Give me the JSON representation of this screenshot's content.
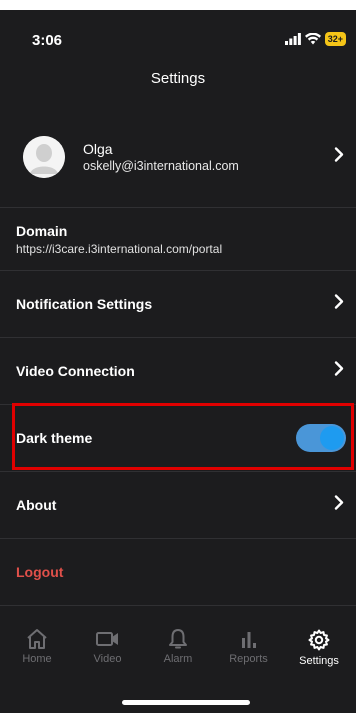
{
  "status_bar": {
    "time": "3:06",
    "battery": "32+"
  },
  "header": {
    "title": "Settings"
  },
  "profile": {
    "name": "Olga",
    "email": "oskelly@i3international.com"
  },
  "domain": {
    "label": "Domain",
    "url": "https://i3care.i3international.com/portal"
  },
  "menu": {
    "notification_settings": "Notification Settings",
    "video_connection": "Video Connection",
    "dark_theme": "Dark theme",
    "about": "About",
    "logout": "Logout"
  },
  "dark_theme_enabled": true,
  "colors": {
    "background": "#1c1c1e",
    "accent": "#1e9bf0",
    "logout": "#e0504a",
    "highlight": "#e00000"
  },
  "tabs": [
    {
      "label": "Home",
      "icon": "home-icon",
      "active": false
    },
    {
      "label": "Video",
      "icon": "video-icon",
      "active": false
    },
    {
      "label": "Alarm",
      "icon": "bell-icon",
      "active": false
    },
    {
      "label": "Reports",
      "icon": "bar-chart-icon",
      "active": false
    },
    {
      "label": "Settings",
      "icon": "gear-icon",
      "active": true
    }
  ]
}
